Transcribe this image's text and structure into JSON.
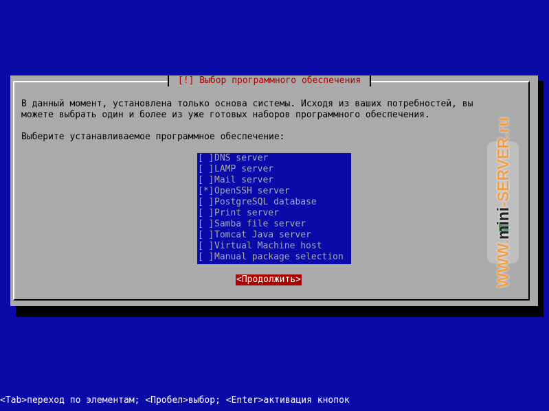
{
  "dialog": {
    "title": " [!] Выбор программного обеспечения ",
    "description_line1": "В данный момент, установлена только основа системы. Исходя из ваших потребностей, вы",
    "description_line2": "можете выбрать один и более из уже готовых наборов программного обеспечения.",
    "prompt": "Выберите устанавливаемое программное обеспечение:",
    "items": [
      {
        "check": "[ ]",
        "label": "DNS server"
      },
      {
        "check": "[ ]",
        "label": "LAMP server"
      },
      {
        "check": "[ ]",
        "label": "Mail server"
      },
      {
        "check": "[*]",
        "label": "OpenSSH server"
      },
      {
        "check": "[ ]",
        "label": "PostgreSQL database"
      },
      {
        "check": "[ ]",
        "label": "Print server"
      },
      {
        "check": "[ ]",
        "label": "Samba file server"
      },
      {
        "check": "[ ]",
        "label": "Tomcat Java server"
      },
      {
        "check": "[ ]",
        "label": "Virtual Machine host"
      },
      {
        "check": "[ ]",
        "label": "Manual package selection"
      }
    ],
    "continue_label": "<Продолжить>"
  },
  "watermark": {
    "prefix": "WWW.",
    "middle": "mini",
    "suffix": "-SERVER.ru"
  },
  "statusbar": {
    "text": "<Tab>переход по элементам; <Пробел>выбор; <Enter>активация кнопок"
  },
  "colors": {
    "background": "#0a0aa8",
    "dialog": "#aaaaaa",
    "title": "#aa0000",
    "button_active": "#aa0000",
    "list_background": "#0a0aa8",
    "list_text": "#aaaaaa"
  }
}
